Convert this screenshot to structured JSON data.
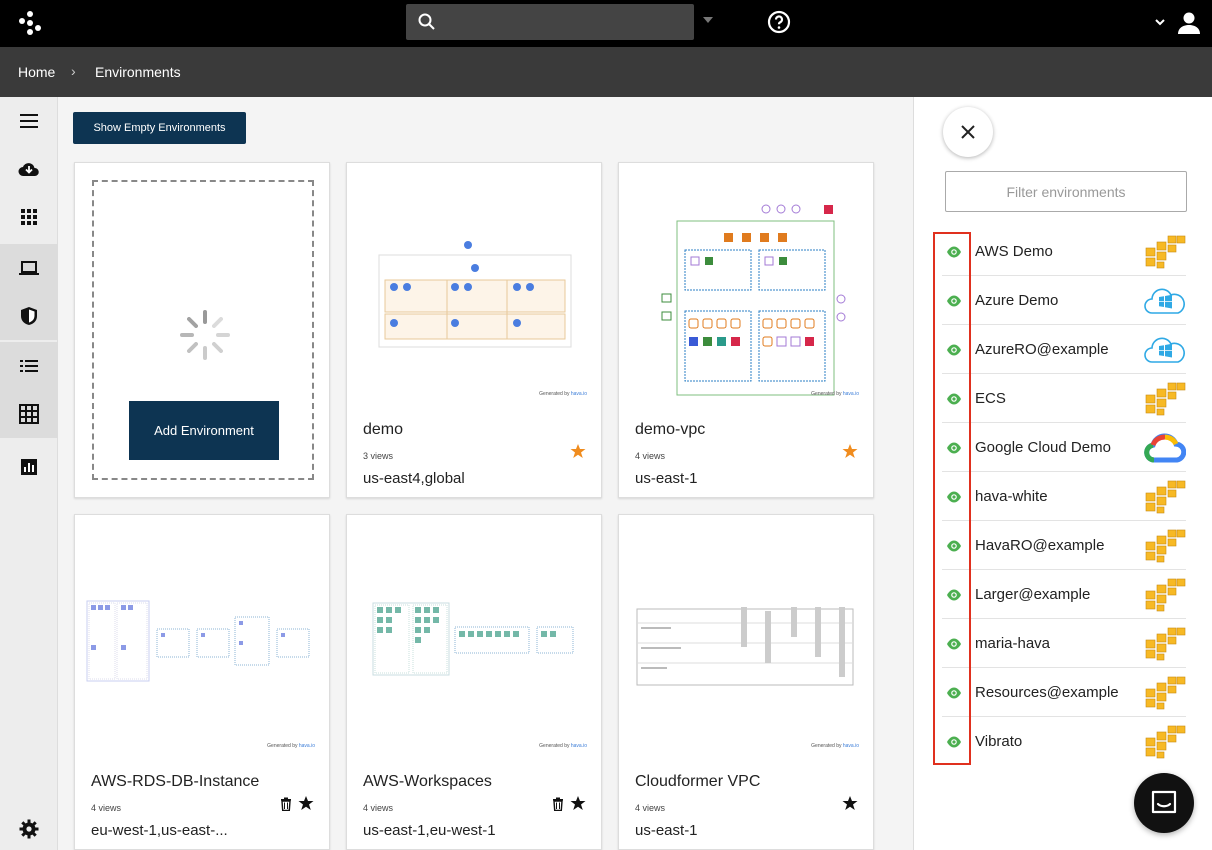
{
  "topbar": {
    "search_value": "",
    "icons": [
      "logo-icon",
      "search-icon",
      "chevron-down-icon",
      "help-icon",
      "chevron-down-icon",
      "user-icon"
    ]
  },
  "breadcrumb": {
    "home": "Home",
    "separator": "›",
    "current": "Environments"
  },
  "sidebar": {
    "items": [
      "menu-icon",
      "cloud-download-icon",
      "apps-grid-icon",
      "laptop-icon",
      "shield-icon",
      "list-icon",
      "table-grid-icon",
      "bar-chart-icon",
      "gear-icon"
    ]
  },
  "main": {
    "show_empty_label": "Show Empty Environments",
    "add_environment_label": "Add Environment",
    "generated_by": "Generated by",
    "generated_brand": "hava.io",
    "cards": [
      {
        "title": "demo",
        "views": "3 views",
        "region": "us-east4,global",
        "starred": true,
        "deletable": false
      },
      {
        "title": "demo-vpc",
        "views": "4 views",
        "region": "us-east-1",
        "starred": true,
        "deletable": false
      },
      {
        "title": "AWS-RDS-DB-Instance",
        "views": "4 views",
        "region": "eu-west-1,us-east-...",
        "starred": false,
        "deletable": true
      },
      {
        "title": "AWS-Workspaces",
        "views": "4 views",
        "region": "us-east-1,eu-west-1",
        "starred": false,
        "deletable": true
      },
      {
        "title": "Cloudformer VPC",
        "views": "4 views",
        "region": "us-east-1",
        "starred": false,
        "deletable": false
      }
    ]
  },
  "panel": {
    "filter_placeholder": "Filter environments",
    "environments": [
      {
        "name": "AWS Demo",
        "provider": "aws"
      },
      {
        "name": "Azure Demo",
        "provider": "azure"
      },
      {
        "name": "AzureRO@example",
        "provider": "azure"
      },
      {
        "name": "ECS",
        "provider": "aws"
      },
      {
        "name": "Google Cloud Demo",
        "provider": "gcp"
      },
      {
        "name": "hava-white",
        "provider": "aws"
      },
      {
        "name": "HavaRO@example",
        "provider": "aws"
      },
      {
        "name": "Larger@example",
        "provider": "aws"
      },
      {
        "name": "maria-hava",
        "provider": "aws"
      },
      {
        "name": "Resources@example",
        "provider": "aws"
      },
      {
        "name": "Vibrato",
        "provider": "aws"
      }
    ]
  },
  "colors": {
    "topbar": "#000000",
    "breadcrumb_bar": "#3a3a3a",
    "primary_button": "#0d3452",
    "star_active": "#f08c1e",
    "eye": "#4caf50",
    "highlight": "#e0301e",
    "aws": "#f7b924",
    "azure": "#2fa9e5"
  }
}
